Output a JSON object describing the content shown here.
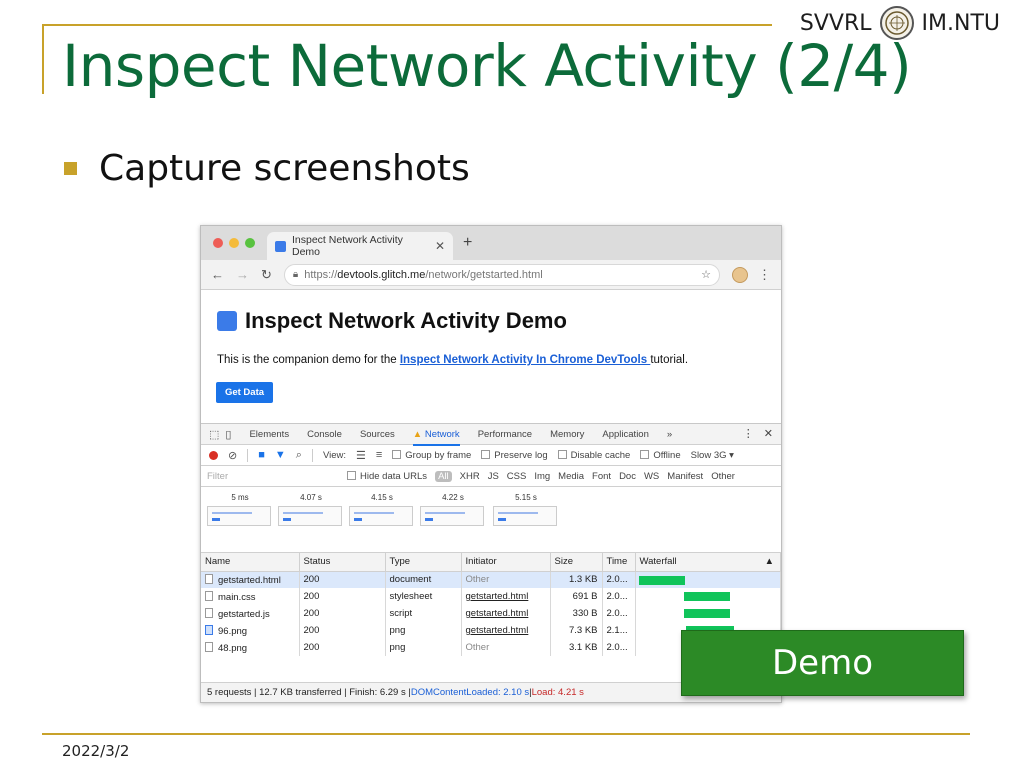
{
  "slide": {
    "title": "Inspect Network Activity (2/4)",
    "brand_left": "SVVRL",
    "brand_right": "IM.NTU",
    "bullet": "Capture screenshots",
    "date": "2022/3/2",
    "demo_button": "Demo"
  },
  "browser": {
    "tab_title": "Inspect Network Activity Demo",
    "url_prefix": "https://",
    "url_host": "devtools.glitch.me",
    "url_path": "/network/getstarted.html"
  },
  "page": {
    "heading": "Inspect Network Activity Demo",
    "text_before": "This is the companion demo for the ",
    "link": "Inspect Network Activity In Chrome DevTools ",
    "text_after": "tutorial.",
    "button": "Get Data"
  },
  "devtools": {
    "tabs": [
      "Elements",
      "Console",
      "Sources",
      "Network",
      "Performance",
      "Memory",
      "Application"
    ],
    "more": "»",
    "toolbar": {
      "view": "View:",
      "group_by_frame": "Group by frame",
      "preserve_log": "Preserve log",
      "disable_cache": "Disable cache",
      "offline": "Offline",
      "throttle": "Slow 3G"
    },
    "filter": {
      "placeholder": "Filter",
      "hide_data_urls": "Hide data URLs",
      "types": [
        "All",
        "XHR",
        "JS",
        "CSS",
        "Img",
        "Media",
        "Font",
        "Doc",
        "WS",
        "Manifest",
        "Other"
      ]
    },
    "filmstrip": [
      "5 ms",
      "4.07 s",
      "4.15 s",
      "4.22 s",
      "5.15 s"
    ],
    "columns": [
      "Name",
      "Status",
      "Type",
      "Initiator",
      "Size",
      "Time",
      "Waterfall"
    ],
    "rows": [
      {
        "name": "getstarted.html",
        "status": "200",
        "type": "document",
        "initiator": "Other",
        "size": "1.3 KB",
        "time": "2.0..."
      },
      {
        "name": "main.css",
        "status": "200",
        "type": "stylesheet",
        "initiator": "getstarted.html",
        "size": "691 B",
        "time": "2.0..."
      },
      {
        "name": "getstarted.js",
        "status": "200",
        "type": "script",
        "initiator": "getstarted.html",
        "size": "330 B",
        "time": "2.0..."
      },
      {
        "name": "96.png",
        "status": "200",
        "type": "png",
        "initiator": "getstarted.html",
        "size": "7.3 KB",
        "time": "2.1..."
      },
      {
        "name": "48.png",
        "status": "200",
        "type": "png",
        "initiator": "Other",
        "size": "3.1 KB",
        "time": "2.0..."
      }
    ],
    "status": {
      "summary": "5 requests | 12.7 KB transferred | Finish: 6.29 s | ",
      "dcl": "DOMContentLoaded: 2.10 s",
      "sep": " | ",
      "load": "Load: 4.21 s"
    }
  }
}
